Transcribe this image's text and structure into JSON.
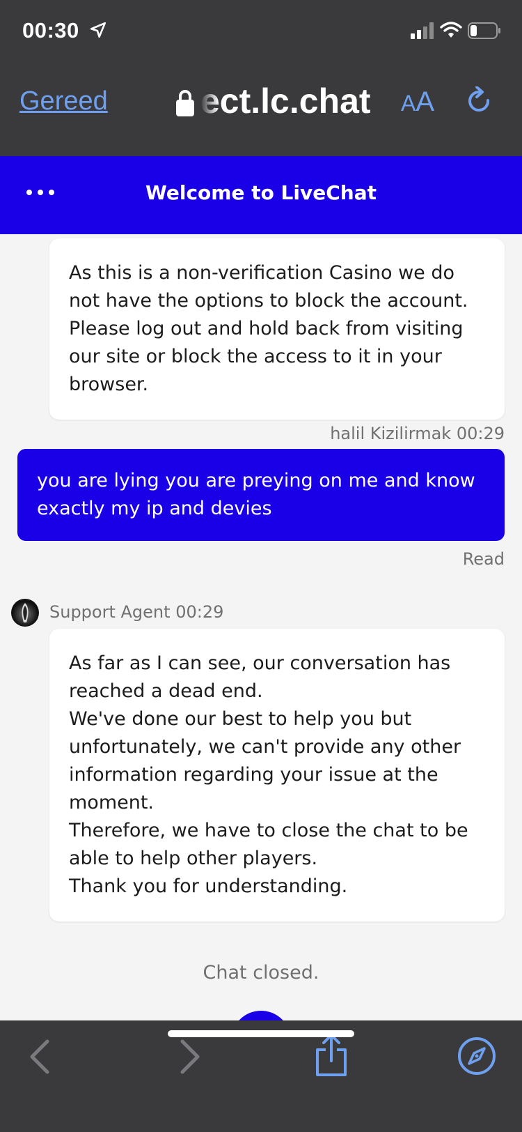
{
  "status_bar": {
    "time": "00:30"
  },
  "browser": {
    "done_label": "Gereed",
    "url": "ect.lc.chat",
    "text_size_label_small": "A",
    "text_size_label_large": "A"
  },
  "livechat": {
    "title": "Welcome to LiveChat"
  },
  "messages": [
    {
      "from": "agent",
      "lines": [
        "As this is a non-verification Casino we do not have the options to block the account. Please log out and hold back from visiting our site or block the access to it in your browser."
      ]
    },
    {
      "from": "user",
      "author": "halil Kizilirmak",
      "time": "00:29",
      "text": "you are lying you are preying on me and know exactly my ip and devies",
      "receipt": "Read"
    },
    {
      "from": "agent",
      "author": "Support Agent",
      "time": "00:29",
      "lines": [
        "As far as I can see, our conversation has reached a dead end.",
        "We've done our best to help you but unfortunately, we can't provide any other information regarding your issue at the moment.",
        "Therefore, we have to close the chat to be able to help other players.",
        "Thank you for understanding."
      ]
    }
  ],
  "chat_status": "Chat closed.",
  "toolbar": {
    "icons": [
      "back-icon",
      "forward-icon",
      "share-icon",
      "compass-icon"
    ],
    "accent": "#6fa0f0"
  },
  "colors": {
    "brand": "#1a00e6",
    "browser_chrome": "#3a3a3c"
  }
}
